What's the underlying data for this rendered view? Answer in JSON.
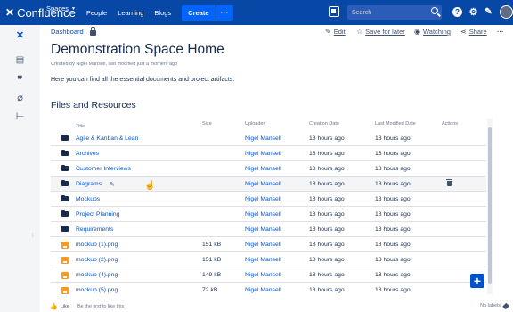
{
  "nav": {
    "logo": "Confluence",
    "spaces": "Spaces",
    "people": "People",
    "learning": "Learning",
    "blogs": "Blogs",
    "create": "Create",
    "more": "···",
    "search_placeholder": "Search",
    "brand_color": "#0747a6"
  },
  "page": {
    "breadcrumb": "Dashboard",
    "actions": {
      "edit": "Edit",
      "save": "Save for later",
      "watch": "Watching",
      "share": "Share",
      "more": "···"
    },
    "title": "Demonstration Space Home",
    "byline": "Created by Nigel Mansell, last modified just a moment ago",
    "intro": "Here you can find all the essential documents and project artifacts.",
    "section": "Files and Resources"
  },
  "table": {
    "headers": [
      "Title",
      "Size",
      "Uploader",
      "Creation Date",
      "Last Modified Date",
      "Actions"
    ],
    "rows": [
      {
        "type": "folder",
        "name": "Agile & Kanban & Lean",
        "size": "",
        "uploader": "Nigel Mansell",
        "created": "18 hours ago",
        "modified": "18 hours ago"
      },
      {
        "type": "folder",
        "name": "Archives",
        "size": "",
        "uploader": "Nigel Mansell",
        "created": "18 hours ago",
        "modified": "18 hours ago"
      },
      {
        "type": "folder",
        "name": "Customer Interviews",
        "size": "",
        "uploader": "Nigel Mansell",
        "created": "18 hours ago",
        "modified": "18 hours ago"
      },
      {
        "type": "folder",
        "name": "Diagrams",
        "size": "",
        "uploader": "Nigel Mansell",
        "created": "18 hours ago",
        "modified": "18 hours ago"
      },
      {
        "type": "folder",
        "name": "Mockups",
        "size": "",
        "uploader": "Nigel Mansell",
        "created": "18 hours ago",
        "modified": "18 hours ago"
      },
      {
        "type": "folder",
        "name": "Project Planning",
        "size": "",
        "uploader": "Nigel Mansell",
        "created": "18 hours ago",
        "modified": "18 hours ago"
      },
      {
        "type": "folder",
        "name": "Requirements",
        "size": "",
        "uploader": "Nigel Mansell",
        "created": "18 hours ago",
        "modified": "18 hours ago"
      },
      {
        "type": "image",
        "name": "mockup (1).png",
        "size": "151 kB",
        "uploader": "Nigel Mansell",
        "created": "18 hours ago",
        "modified": "18 hours ago"
      },
      {
        "type": "image",
        "name": "mockup (2).png",
        "size": "151 kB",
        "uploader": "Nigel Mansell",
        "created": "18 hours ago",
        "modified": "18 hours ago"
      },
      {
        "type": "image",
        "name": "mockup (4).png",
        "size": "149 kB",
        "uploader": "Nigel Mansell",
        "created": "18 hours ago",
        "modified": "18 hours ago"
      },
      {
        "type": "image",
        "name": "mockup (5).png",
        "size": "72 kB",
        "uploader": "Nigel Mansell",
        "created": "18 hours ago",
        "modified": "18 hours ago"
      }
    ]
  },
  "footer": {
    "like": "Like",
    "first": "Be the first to like this",
    "labels": "No labels"
  }
}
